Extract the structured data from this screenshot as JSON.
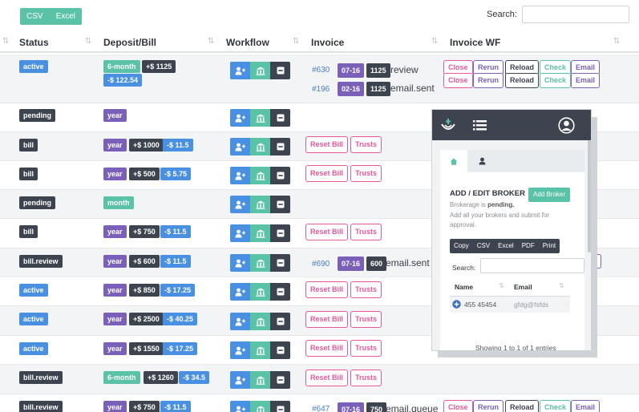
{
  "toolbar": {
    "csv_label": "CSV",
    "excel_label": "Excel",
    "search_label": "Search:",
    "search_value": ""
  },
  "table": {
    "columns": [
      "Status",
      "Deposit/Bill",
      "Workflow",
      "Invoice",
      "Invoice WF"
    ],
    "actions": {
      "reset_bill": "Reset Bill",
      "trusts": "Trusts",
      "close": "Close",
      "rerun": "Rerun",
      "reload": "Reload",
      "check": "Check",
      "email": "Email"
    },
    "rows": [
      {
        "status": "active",
        "status_color": "#4a90e2",
        "term": "6-month",
        "term_color": "#5ac2a6",
        "deposit": "+$ 1125",
        "bill": "-$ 122.54",
        "invoices": [
          {
            "id": "#630",
            "date": "07-16",
            "amount": "1125",
            "text": "review"
          },
          {
            "id": "#196",
            "date": "02-16",
            "amount": "1125",
            "text": "email.sent"
          }
        ]
      },
      {
        "status": "pending",
        "status_color": "#3d444f",
        "term": "year",
        "term_color": "#7a60b8"
      },
      {
        "status": "bill",
        "status_color": "#3d444f",
        "term": "year",
        "term_color": "#7a60b8",
        "deposit": "+$ 1000",
        "bill": "-$ 11.5"
      },
      {
        "status": "bill",
        "status_color": "#3d444f",
        "term": "year",
        "term_color": "#7a60b8",
        "deposit": "+$ 500",
        "bill": "-$ 5.75"
      },
      {
        "status": "pending",
        "status_color": "#3d444f",
        "term": "month",
        "term_color": "#5ac2a6"
      },
      {
        "status": "bill",
        "status_color": "#3d444f",
        "term": "year",
        "term_color": "#7a60b8",
        "deposit": "+$ 750",
        "bill": "-$ 11.5"
      },
      {
        "status": "bill.review",
        "status_color": "#3d444f",
        "term": "year",
        "term_color": "#7a60b8",
        "deposit": "+$ 600",
        "bill": "-$ 11.5",
        "invoices": [
          {
            "id": "#690",
            "date": "07-16",
            "amount": "600",
            "text": "email.sent"
          }
        ]
      },
      {
        "status": "active",
        "status_color": "#4a90e2",
        "term": "year",
        "term_color": "#7a60b8",
        "deposit": "+$ 850",
        "bill": "-$ 17.25"
      },
      {
        "status": "active",
        "status_color": "#4a90e2",
        "term": "year",
        "term_color": "#7a60b8",
        "deposit": "+$ 2500",
        "bill": "-$ 40.25"
      },
      {
        "status": "active",
        "status_color": "#4a90e2",
        "term": "year",
        "term_color": "#7a60b8",
        "deposit": "+$ 1550",
        "bill": "-$ 17.25"
      },
      {
        "status": "bill.review",
        "status_color": "#3d444f",
        "term": "6-month",
        "term_color": "#5ac2a6",
        "deposit": "+$ 1260",
        "bill": "-$ 34.5"
      },
      {
        "status": "bill.review",
        "status_color": "#3d444f",
        "term": "year",
        "term_color": "#7a60b8",
        "deposit": "+$ 750",
        "bill": "-$ 11.5",
        "invoices": [
          {
            "id": "#647",
            "date": "07-16",
            "amount": "750",
            "text": "email.queue"
          }
        ]
      }
    ]
  },
  "overlay": {
    "title": "ADD / EDIT BROKER",
    "add_button": "Add Broker",
    "status_prefix": "Brokerage is",
    "status_value": "pending.",
    "description": "Add all your brokers and submit for",
    "description_2": "approval.",
    "export_buttons": [
      "Copy",
      "CSV",
      "Excel",
      "PDF",
      "Print"
    ],
    "search_label": "Search:",
    "columns": [
      "Name",
      "Email"
    ],
    "rows": [
      {
        "name": "455 45454",
        "email": "gfdg@fsfds"
      }
    ],
    "footer": "Showing 1 to 1 of 1 entries"
  }
}
